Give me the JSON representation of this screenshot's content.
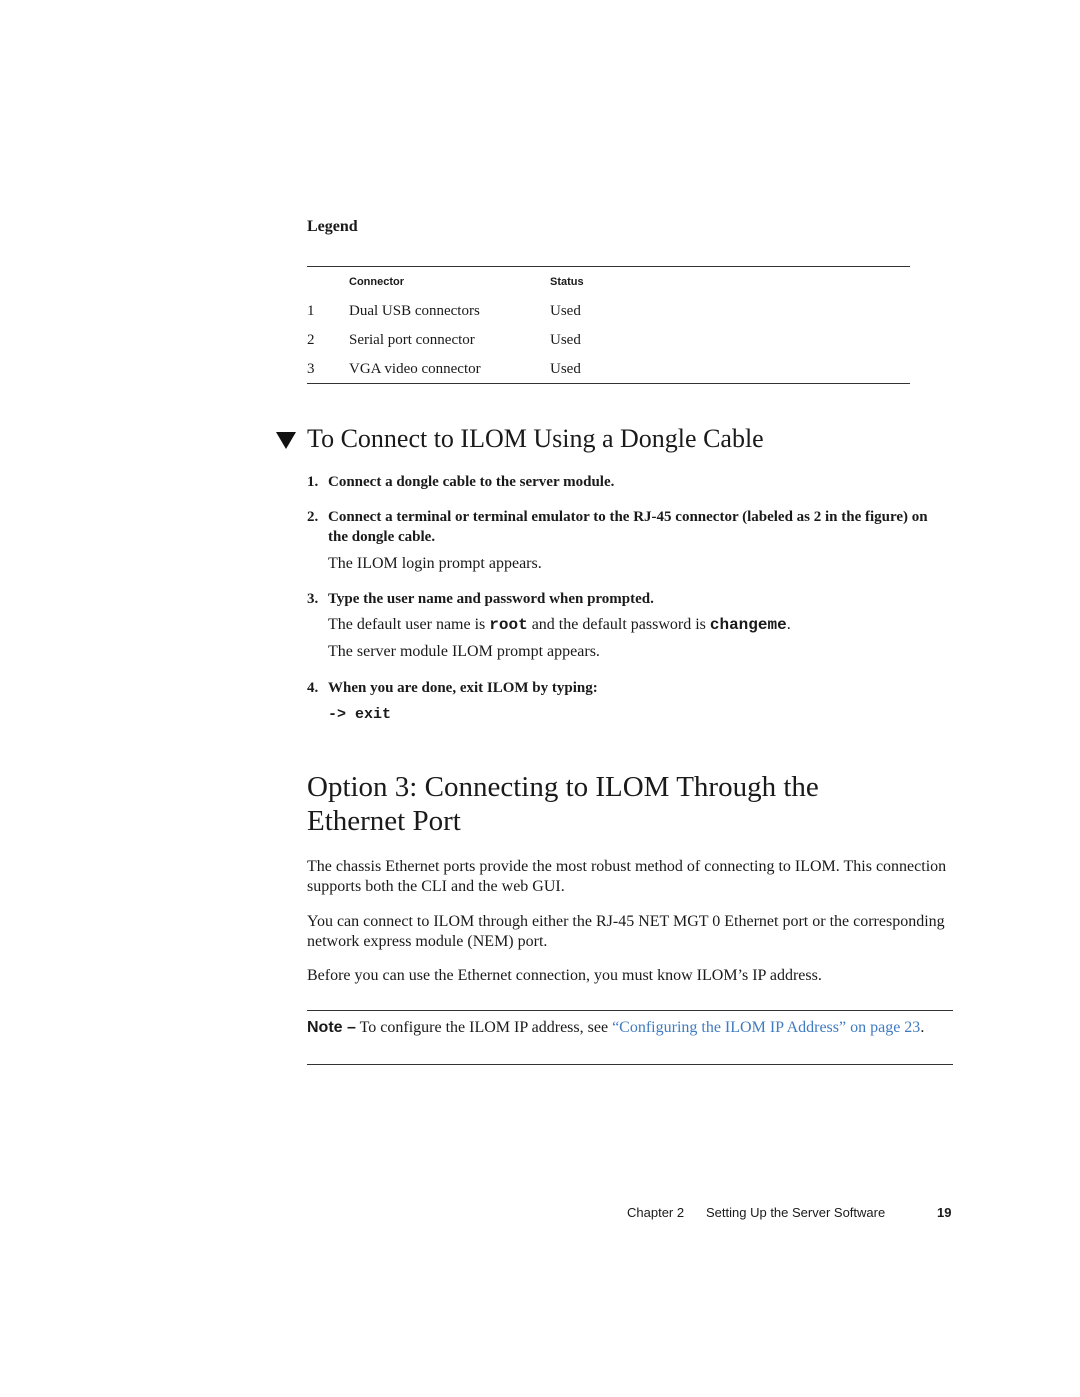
{
  "legend": {
    "title": "Legend",
    "columns": [
      "",
      "Connector",
      "Status"
    ],
    "rows": [
      {
        "num": "1",
        "connector": "Dual USB connectors",
        "status": "Used"
      },
      {
        "num": "2",
        "connector": "Serial port connector",
        "status": "Used"
      },
      {
        "num": "3",
        "connector": "VGA video connector",
        "status": "Used"
      }
    ]
  },
  "procedure": {
    "icon": "triangle-down-icon",
    "title": "To Connect to ILOM Using a Dongle Cable",
    "steps": [
      {
        "num": "1.",
        "text": "Connect a dongle cable to the server module."
      },
      {
        "num": "2.",
        "text": "Connect a terminal or terminal emulator to the RJ-45 connector (labeled as 2 in the figure) on the dongle cable.",
        "result": "The ILOM login prompt appears."
      },
      {
        "num": "3.",
        "text": "Type the user name and password when prompted.",
        "detail_pre": "The default user name is ",
        "detail_user": "root",
        "detail_mid": " and the default password is ",
        "detail_pass": "changeme",
        "detail_post": ".",
        "result": "The server module ILOM prompt appears."
      },
      {
        "num": "4.",
        "text": "When you are done, exit ILOM by typing:",
        "command": "-> exit"
      }
    ]
  },
  "section": {
    "title_line1": "Option 3: Connecting to ILOM Through the",
    "title_line2": "Ethernet Port",
    "paragraphs": [
      "The chassis Ethernet ports provide the most robust method of connecting to ILOM. This connection supports both the CLI and the web GUI.",
      "You can connect to ILOM through either the RJ-45 NET MGT 0 Ethernet port or the corresponding network express module (NEM) port.",
      "Before you can use the Ethernet connection, you must know ILOM’s IP address."
    ]
  },
  "note": {
    "label": "Note –",
    "text": " To configure the ILOM IP address, see ",
    "link_text": "“Configuring the ILOM IP Address” on page 23",
    "end": "."
  },
  "footer": {
    "chapter": "Chapter 2",
    "title": "Setting Up the Server Software",
    "page": "19"
  },
  "colors": {
    "link": "#3f7bc1",
    "text": "#1a1a1a"
  }
}
